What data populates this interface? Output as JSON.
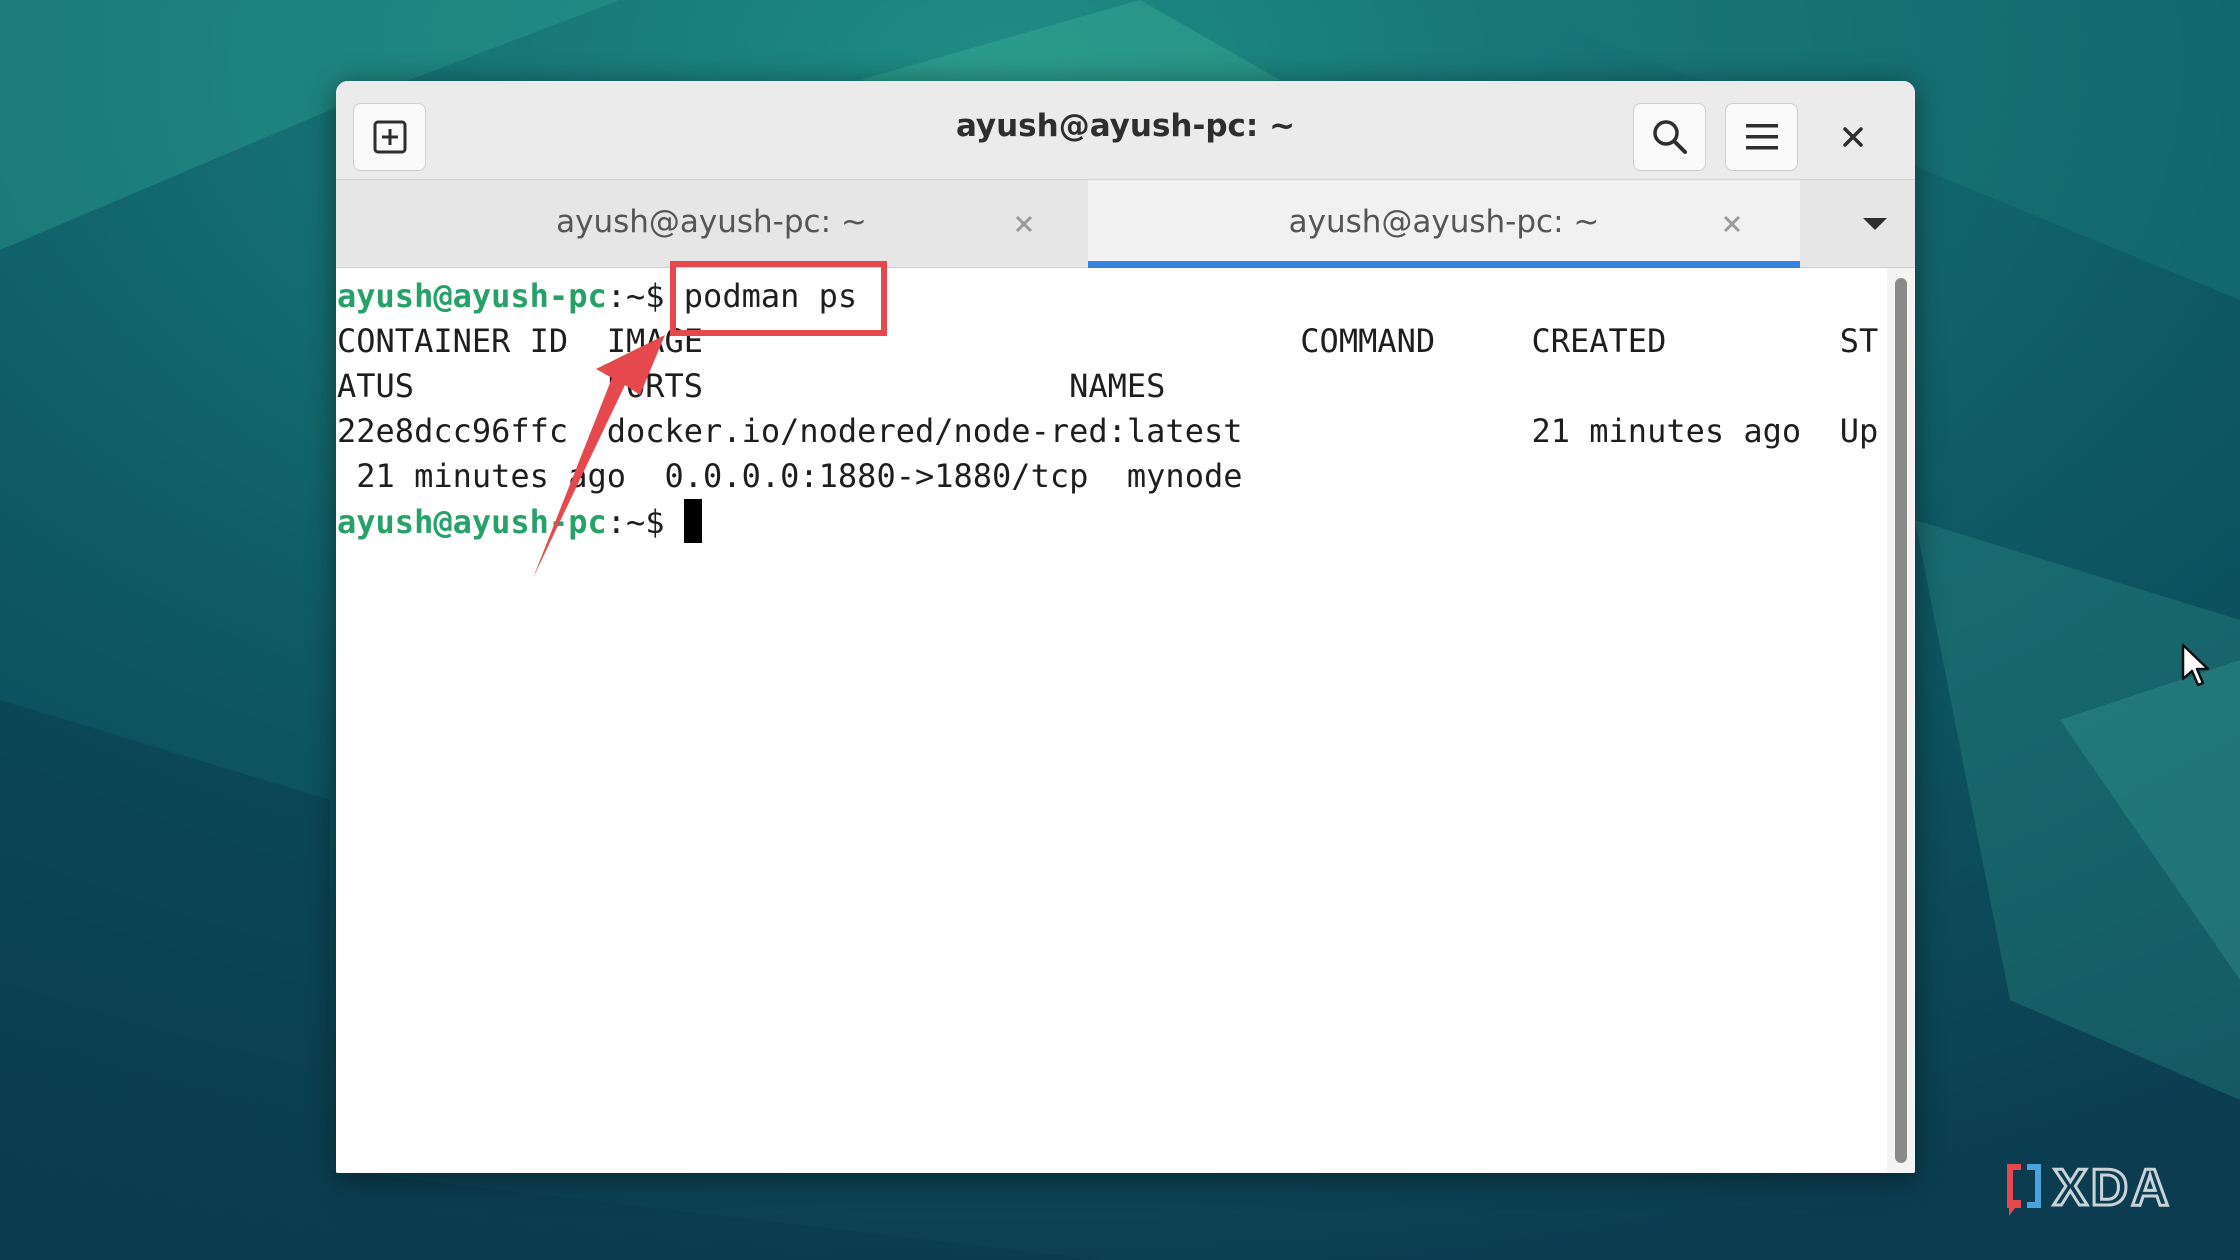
{
  "window": {
    "title": "ayush@ayush-pc: ~"
  },
  "tabs": [
    {
      "label": "ayush@ayush-pc: ~",
      "active": false
    },
    {
      "label": "ayush@ayush-pc: ~",
      "active": true
    }
  ],
  "terminal": {
    "prompt_user": "ayush@ayush-pc",
    "prompt_suffix": ":~$ ",
    "command": "podman ps",
    "output": [
      "CONTAINER ID  IMAGE                               COMMAND     CREATED         ST",
      "ATUS          PORTS                   NAMES",
      "22e8dcc96ffc  docker.io/nodered/node-red:latest               21 minutes ago  Up",
      " 21 minutes ago  0.0.0.0:1880->1880/tcp  mynode"
    ]
  },
  "watermark": "XDA",
  "colors": {
    "prompt_green": "#26a269",
    "tab_accent": "#3584e4",
    "annotation_red": "#e5484d"
  },
  "icons": {
    "new_tab": "new-tab-icon",
    "search": "search-icon",
    "menu": "hamburger-menu-icon",
    "close": "close-icon",
    "tab_close": "tab-close-icon",
    "dropdown": "chevron-down-icon"
  }
}
